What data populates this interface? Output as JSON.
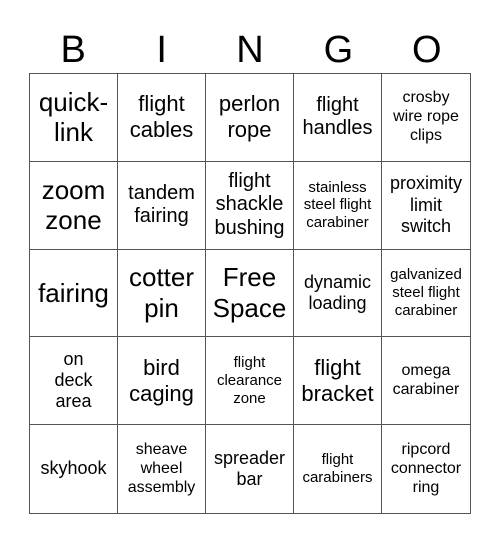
{
  "header": {
    "letters": [
      "B",
      "I",
      "N",
      "G",
      "O"
    ]
  },
  "cells": [
    {
      "text": "quick-link",
      "lines": [
        "quick-",
        "link"
      ],
      "size": "s1"
    },
    {
      "text": "flight cables",
      "lines": [
        "flight",
        "cables"
      ],
      "size": "s2"
    },
    {
      "text": "perlon rope",
      "lines": [
        "perlon",
        "rope"
      ],
      "size": "s2"
    },
    {
      "text": "flight handles",
      "lines": [
        "flight",
        "handles"
      ],
      "size": "s3"
    },
    {
      "text": "crosby wire rope clips",
      "lines": [
        "crosby",
        "wire rope",
        "clips"
      ],
      "size": "s5"
    },
    {
      "text": "zoom zone",
      "lines": [
        "zoom",
        "zone"
      ],
      "size": "s1"
    },
    {
      "text": "tandem fairing",
      "lines": [
        "tandem",
        "fairing"
      ],
      "size": "s3"
    },
    {
      "text": "flight shackle bushing",
      "lines": [
        "flight",
        "shackle",
        "bushing"
      ],
      "size": "s3"
    },
    {
      "text": "stainless steel flight carabiner",
      "lines": [
        "stainless",
        "steel flight",
        "carabiner"
      ],
      "size": "s6"
    },
    {
      "text": "proximity limit switch",
      "lines": [
        "proximity",
        "limit",
        "switch"
      ],
      "size": "s4"
    },
    {
      "text": "fairing",
      "lines": [
        "fairing"
      ],
      "size": "s1"
    },
    {
      "text": "cotter pin",
      "lines": [
        "cotter",
        "pin"
      ],
      "size": "s1"
    },
    {
      "text": "Free Space",
      "lines": [
        "Free",
        "Space"
      ],
      "size": "s1"
    },
    {
      "text": "dynamic loading",
      "lines": [
        "dynamic",
        "loading"
      ],
      "size": "s4"
    },
    {
      "text": "galvanized steel flight carabiner",
      "lines": [
        "galvanized",
        "steel flight",
        "carabiner"
      ],
      "size": "s6"
    },
    {
      "text": "on deck area",
      "lines": [
        "on",
        "deck",
        "area"
      ],
      "size": "s4"
    },
    {
      "text": "bird caging",
      "lines": [
        "bird",
        "caging"
      ],
      "size": "s2"
    },
    {
      "text": "flight clearance zone",
      "lines": [
        "flight",
        "clearance",
        "zone"
      ],
      "size": "s6"
    },
    {
      "text": "flight bracket",
      "lines": [
        "flight",
        "bracket"
      ],
      "size": "s2"
    },
    {
      "text": "omega carabiner",
      "lines": [
        "omega",
        "carabiner"
      ],
      "size": "s5"
    },
    {
      "text": "skyhook",
      "lines": [
        "skyhook"
      ],
      "size": "s4"
    },
    {
      "text": "sheave wheel assembly",
      "lines": [
        "sheave",
        "wheel",
        "assembly"
      ],
      "size": "s5"
    },
    {
      "text": "spreader bar",
      "lines": [
        "spreader",
        "bar"
      ],
      "size": "s4"
    },
    {
      "text": "flight carabiners",
      "lines": [
        "flight",
        "carabiners"
      ],
      "size": "s6"
    },
    {
      "text": "ripcord connector ring",
      "lines": [
        "ripcord",
        "connector",
        "ring"
      ],
      "size": "s5"
    }
  ]
}
